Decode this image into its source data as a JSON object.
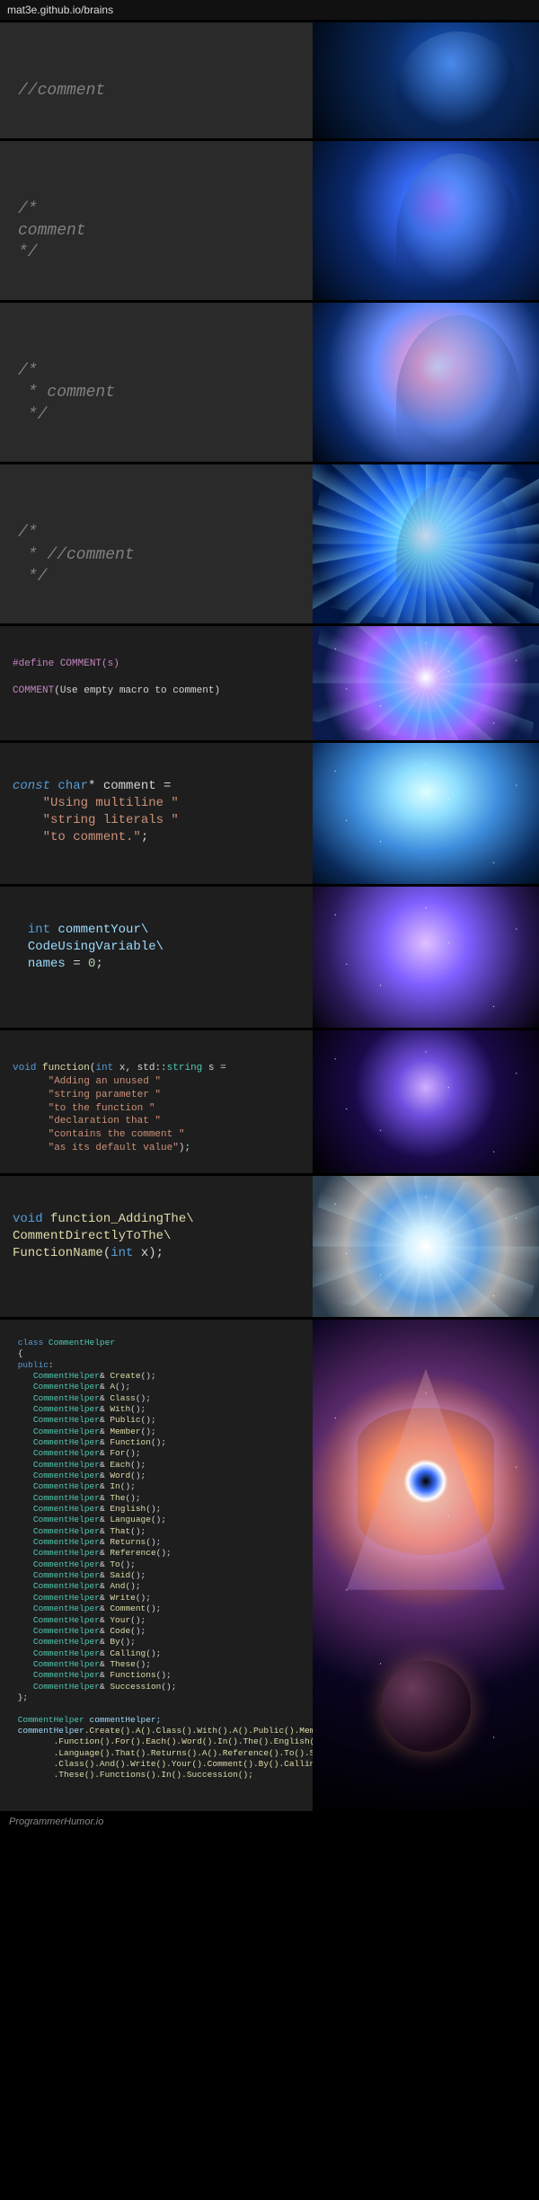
{
  "url": "mat3e.github.io/brains",
  "panels": {
    "p1": {
      "line1": "//comment"
    },
    "p2": {
      "line1": "/*",
      "line2": "comment",
      "line3": "*/"
    },
    "p3": {
      "line1": "/*",
      "line2": " * comment",
      "line3": " */"
    },
    "p4": {
      "line1": "/*",
      "line2": " * //comment",
      "line3": " */"
    },
    "p5": {
      "def_pre": "#define",
      "def_name": " COMMENT(s)",
      "call_macro": "COMMENT",
      "call_args": "(Use empty macro to comment)"
    },
    "p6": {
      "kw_const": "const",
      "kw_char": " char",
      "star_name": "* comment",
      "eq": " =",
      "s1": "\"Using multiline \"",
      "s2": "\"string literals \"",
      "s3": "\"to comment.\"",
      "semi": ";"
    },
    "p7": {
      "kw_int": "int",
      "name1": " commentYour\\",
      "name2": "CodeUsingVariable\\",
      "name3": "names",
      "eq": " = ",
      "zero": "0",
      "semi": ";"
    },
    "p8": {
      "kw_void": "void",
      "fn": " function",
      "sig1": "(",
      "kw_int": "int",
      "sig2": " x, std::",
      "kw_string": "string",
      "sig3": " s =",
      "s1": "\"Adding an unused \"",
      "s2": "\"string parameter \"",
      "s3": "\"to the function \"",
      "s4": "\"declaration that \"",
      "s5": "\"contains the comment \"",
      "s6": "\"as its default value\"",
      "close": ");"
    },
    "p9": {
      "kw_void": "void",
      "fn1": " function_AddingThe\\",
      "fn2": "CommentDirectlyToThe\\",
      "fn3": "FunctionName",
      "sig_open": "(",
      "kw_int": "int",
      "sig_close": " x);"
    },
    "p10": {
      "kw_class": "class",
      "cls_name": " CommentHelper",
      "brace_open": "{",
      "kw_public": "public",
      "colon": ":",
      "type": "CommentHelper",
      "amp": "& ",
      "methods": [
        "Create",
        "A",
        "Class",
        "With",
        "Public",
        "Member",
        "Function",
        "For",
        "Each",
        "Word",
        "In",
        "The",
        "English",
        "Language",
        "That",
        "Returns",
        "Reference",
        "To",
        "Said",
        "And",
        "Write",
        "Comment",
        "Your",
        "Code",
        "By",
        "Calling",
        "These",
        "Functions",
        "Succession"
      ],
      "brace_close": "};",
      "decl_type": "CommentHelper",
      "decl_name": " commentHelper;",
      "chain_head": "commentHelper",
      "chain1": ".Create().A().Class().With().A().Public().Member()",
      "chain2": ".Function().For().Each().Word().In().The().English()",
      "chain3": ".Language().That().Returns().A().Reference().To().Said()",
      "chain4": ".Class().And().Write().Your().Comment().By().Calling()",
      "chain5": ".These().Functions().In().Succession();"
    }
  },
  "watermark": "ProgrammerHumor.io"
}
